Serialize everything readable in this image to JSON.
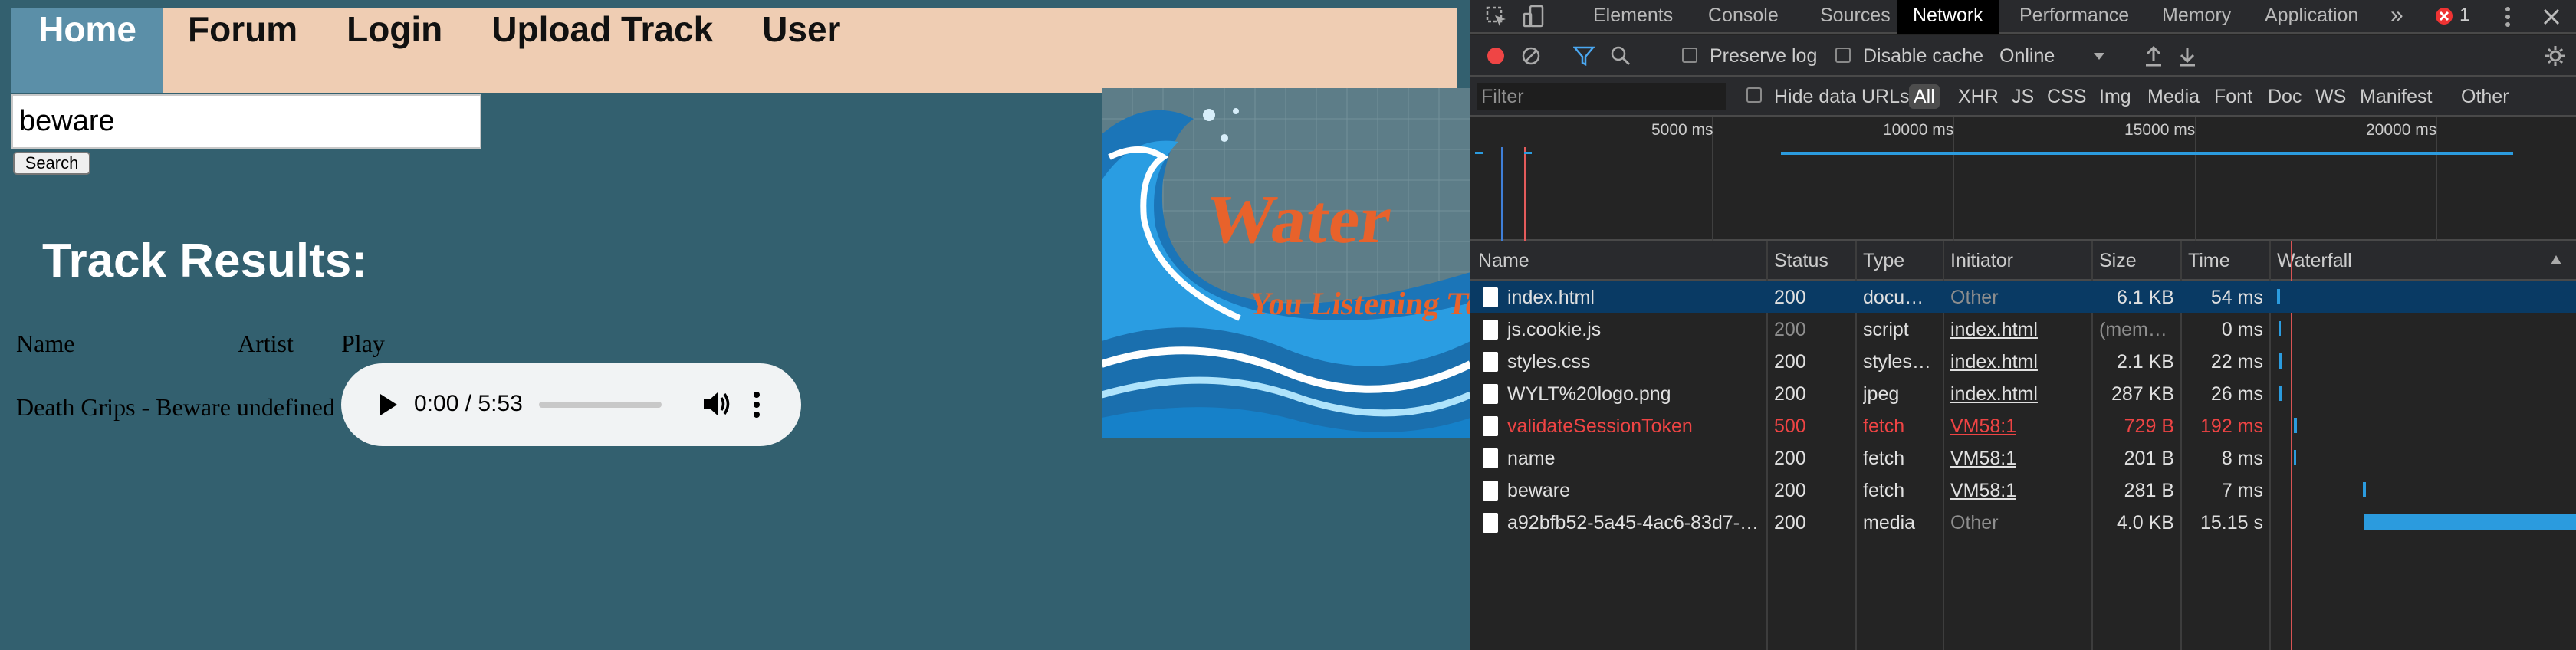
{
  "nav": {
    "items": [
      {
        "label": "Home",
        "active": true
      },
      {
        "label": "Forum"
      },
      {
        "label": "Login"
      },
      {
        "label": "Upload Track"
      },
      {
        "label": "User"
      }
    ]
  },
  "search": {
    "value": "beware",
    "button_label": "Search"
  },
  "results": {
    "heading": "Track Results:",
    "columns": [
      "Name",
      "Artist",
      "Play"
    ],
    "rows": [
      {
        "name": "Death Grips - Beware",
        "artist": "undefined"
      }
    ]
  },
  "audio": {
    "time": "0:00 / 5:53"
  },
  "logo": {
    "line1": "Water",
    "line2": "You Listening To?"
  },
  "devtools": {
    "tabs": [
      "Elements",
      "Console",
      "Sources",
      "Network",
      "Performance",
      "Memory",
      "Application"
    ],
    "active_tab": "Network",
    "more_tabs": "»",
    "error_count": "1",
    "toolbar": {
      "preserve_log": "Preserve log",
      "disable_cache": "Disable cache",
      "throttling": "Online"
    },
    "filter": {
      "placeholder": "Filter",
      "hide_data_urls": "Hide data URLs",
      "types": [
        "All",
        "XHR",
        "JS",
        "CSS",
        "Img",
        "Media",
        "Font",
        "Doc",
        "WS",
        "Manifest",
        "Other"
      ]
    },
    "overview_ticks": [
      "5000 ms",
      "10000 ms",
      "15000 ms",
      "20000 ms"
    ],
    "columns": [
      "Name",
      "Status",
      "Type",
      "Initiator",
      "Size",
      "Time",
      "Waterfall"
    ],
    "requests": [
      {
        "name": "index.html",
        "status": "200",
        "type": "docu…",
        "initiator": "Other",
        "size": "6.1 KB",
        "time": "54 ms"
      },
      {
        "name": "js.cookie.js",
        "status": "200",
        "type": "script",
        "initiator": "index.html",
        "size": "(mem…",
        "time": "0 ms"
      },
      {
        "name": "styles.css",
        "status": "200",
        "type": "styles…",
        "initiator": "index.html",
        "size": "2.1 KB",
        "time": "22 ms"
      },
      {
        "name": "WYLT%20logo.png",
        "status": "200",
        "type": "jpeg",
        "initiator": "index.html",
        "size": "287 KB",
        "time": "26 ms"
      },
      {
        "name": "validateSessionToken",
        "status": "500",
        "type": "fetch",
        "initiator": "VM58:1",
        "size": "729 B",
        "time": "192 ms"
      },
      {
        "name": "name",
        "status": "200",
        "type": "fetch",
        "initiator": "VM58:1",
        "size": "201 B",
        "time": "8 ms"
      },
      {
        "name": "beware",
        "status": "200",
        "type": "fetch",
        "initiator": "VM58:1",
        "size": "281 B",
        "time": "7 ms"
      },
      {
        "name": "a92bfb52-5a45-4ac6-83d7-…",
        "status": "200",
        "type": "media",
        "initiator": "Other",
        "size": "4.0 KB",
        "time": "15.15 s"
      }
    ]
  }
}
